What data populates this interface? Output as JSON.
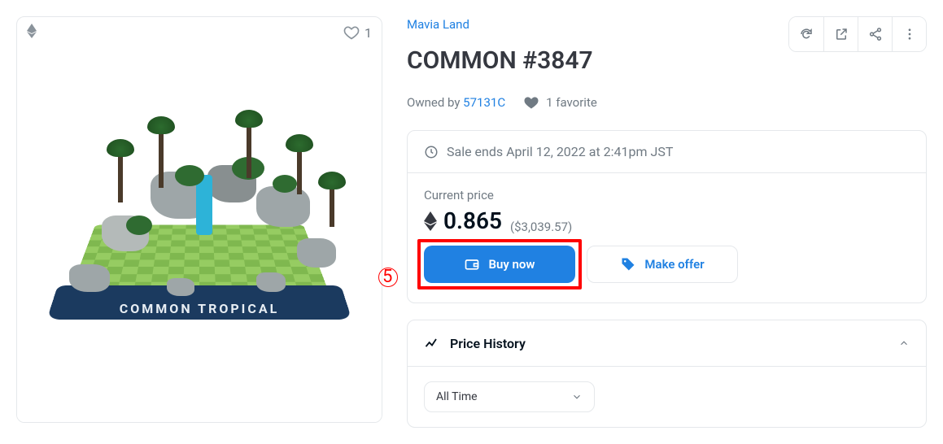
{
  "image_card": {
    "fav_count": "1"
  },
  "terrain_label": "COMMON TROPICAL",
  "collection": "Mavia Land",
  "title": "COMMON #3847",
  "owner": {
    "prefix": "Owned by ",
    "name": "57131C"
  },
  "favorite_text": "1 favorite",
  "sale_end_text": "Sale ends April 12, 2022 at 2:41pm JST",
  "price": {
    "label": "Current price",
    "value": "0.865",
    "usd": "($3,039.57)"
  },
  "buttons": {
    "buy": "Buy now",
    "offer": "Make offer"
  },
  "step_marker": "5",
  "history": {
    "title": "Price History",
    "range": "All Time"
  }
}
